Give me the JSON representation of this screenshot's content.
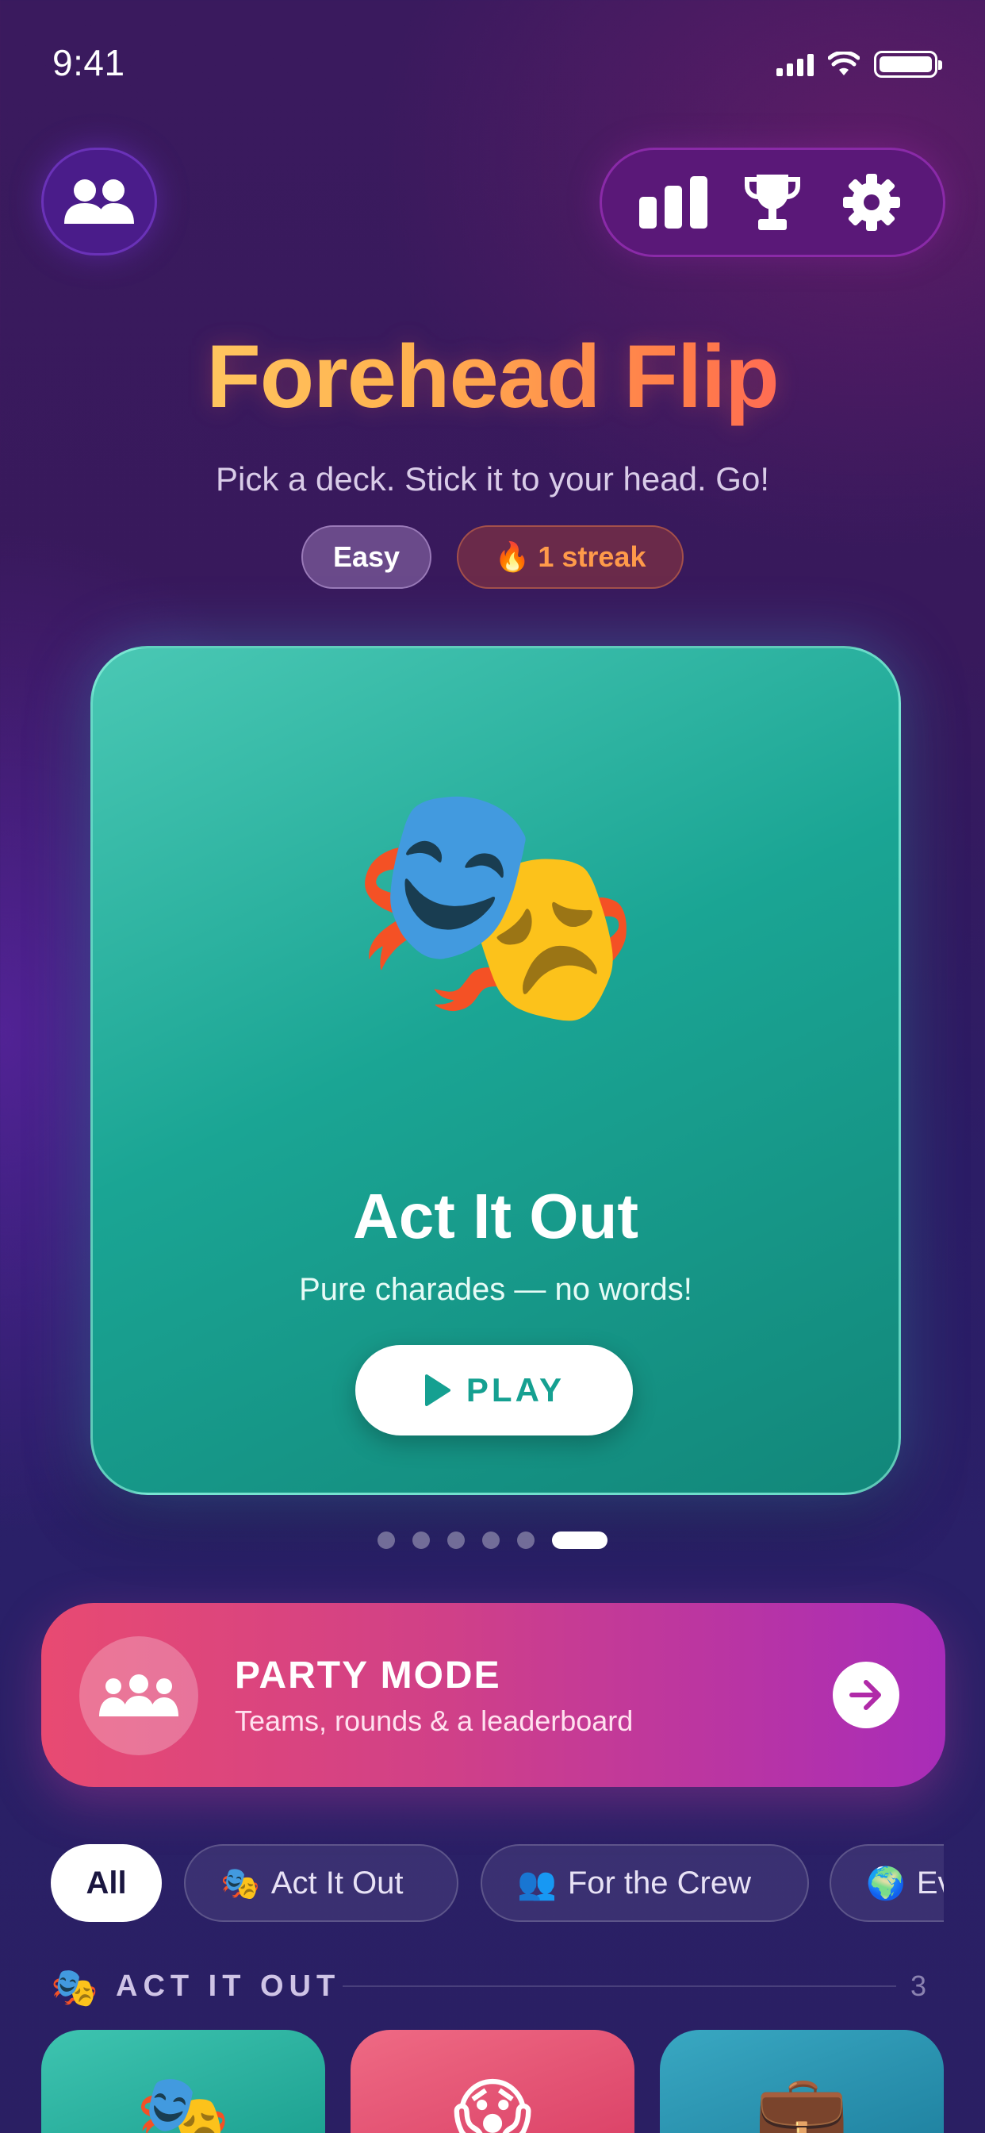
{
  "status_bar": {
    "time": "9:41"
  },
  "header": {
    "title": "Forehead Flip",
    "subtitle": "Pick a deck. Stick it to your head. Go!",
    "difficulty_chip": "Easy",
    "streak_chip": {
      "emoji": "🔥",
      "label": "1 streak"
    }
  },
  "hero_card": {
    "emoji": "🎭",
    "title": "Act It Out",
    "subtitle": "Pure charades — no words!",
    "play_label": "PLAY",
    "page_count": 6,
    "active_page": 6
  },
  "party_mode": {
    "title": "PARTY MODE",
    "subtitle": "Teams, rounds & a leaderboard"
  },
  "filters": [
    {
      "emoji": "",
      "label": "All",
      "selected": true
    },
    {
      "emoji": "🎭",
      "label": "Act It Out",
      "selected": false
    },
    {
      "emoji": "👥",
      "label": "For the Crew",
      "selected": false
    },
    {
      "emoji": "🌍",
      "label": "Ev",
      "selected": false
    }
  ],
  "section": {
    "emoji": "🎭",
    "title": "ACT IT OUT",
    "count": "3"
  },
  "deck_cards": [
    {
      "emoji": "🎭",
      "color": "#2bb3a0"
    },
    {
      "emoji": "😱",
      "color": "#e5506f"
    },
    {
      "emoji": "💼",
      "color": "#2a93b2"
    }
  ],
  "colors": {
    "accent_teal": "#15a091",
    "accent_pink": "#e84a72",
    "accent_purple": "#a82cb8",
    "streak_orange": "#ff9a4a"
  }
}
